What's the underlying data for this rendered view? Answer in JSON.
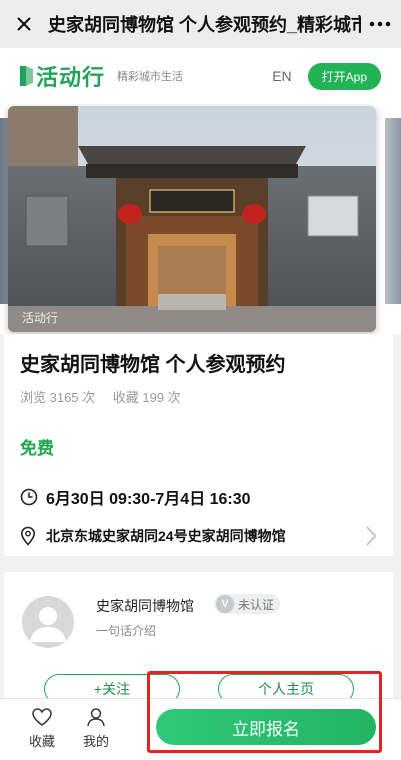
{
  "nav": {
    "title": "史家胡同博物馆 个人参观预约_精彩城市生活"
  },
  "brand": {
    "logo_text": "活动行",
    "tagline": "精彩城市生活",
    "lang": "EN",
    "open_app": "打开App"
  },
  "carousel": {
    "watermark": "活动行"
  },
  "event": {
    "title": "史家胡同博物馆 个人参观预约",
    "views": "浏览 3165 次",
    "favorites": "收藏 199 次",
    "price": "免费",
    "time": "6月30日 09:30-7月4日 16:30",
    "address": "北京东城史家胡同24号史家胡同博物馆"
  },
  "organizer": {
    "name": "史家胡同博物馆",
    "badge": "未认证",
    "badge_letter": "V",
    "intro": "一句话介绍",
    "follow": "+关注",
    "homepage": "个人主页"
  },
  "bottom": {
    "favorite": "收藏",
    "mine": "我的",
    "signup": "立即报名"
  },
  "colors": {
    "brand_green": "#22a35a",
    "signup_green": "#2ec978",
    "highlight_red": "#e52420"
  }
}
